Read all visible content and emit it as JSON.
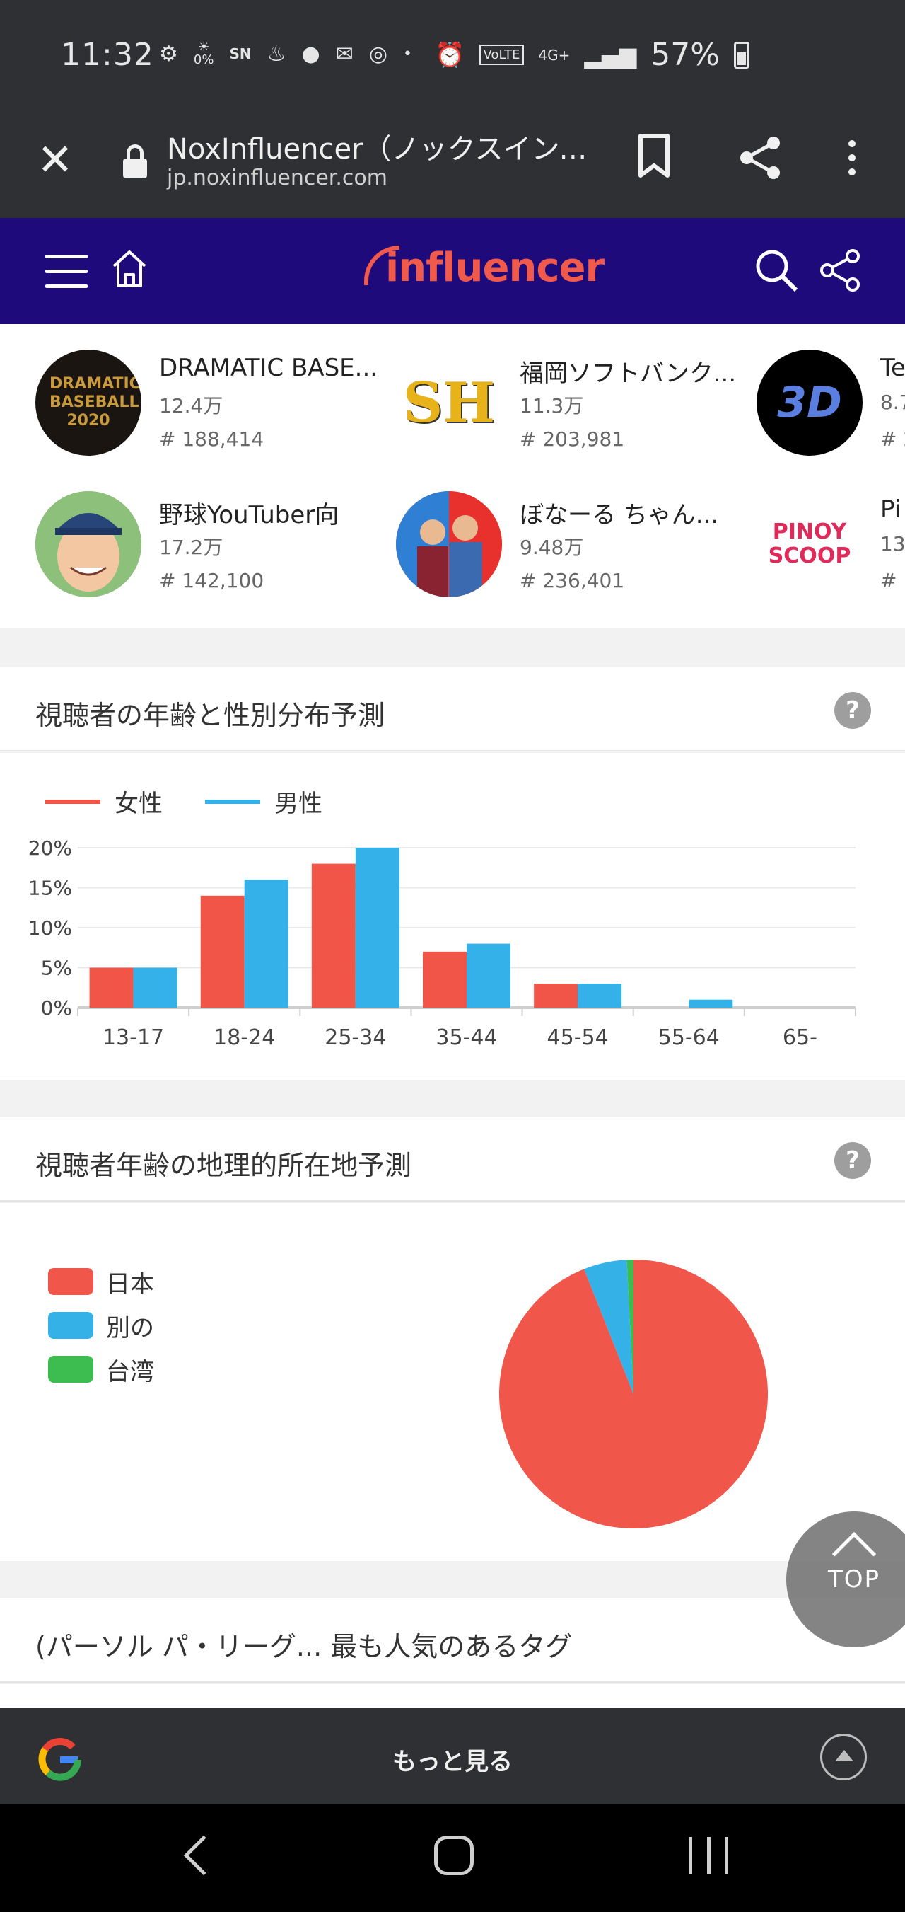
{
  "status_bar": {
    "time": "11:32",
    "notif_percent": "0%",
    "network": "4G+",
    "volte": "VoLTE",
    "battery": "57%"
  },
  "browser": {
    "page_title": "NoxInfluencer（ノックスインフ...",
    "domain": "jp.noxinfluencer.com"
  },
  "site": {
    "logo_text": "influencer",
    "brand_color": "#f05a4d",
    "header_color": "#1f0a7c"
  },
  "related_channels": [
    {
      "name": "DRAMATIC BASE...",
      "subs": "12.4万",
      "rank": "# 188,414",
      "avatar_text": "DRAMATIC BASEBALL 2020"
    },
    {
      "name": "福岡ソフトバンク...",
      "subs": "11.3万",
      "rank": "# 203,981",
      "avatar_text": "SH"
    },
    {
      "name": "Te",
      "subs": "8.7",
      "rank": "# 2",
      "avatar_text": "3D"
    },
    {
      "name": "野球YouTuber向",
      "subs": "17.2万",
      "rank": "# 142,100",
      "avatar_text": ""
    },
    {
      "name": "ぼなーる ちゃん...",
      "subs": "9.48万",
      "rank": "# 236,401",
      "avatar_text": ""
    },
    {
      "name": "Pi",
      "subs": "13",
      "rank": "# 1",
      "avatar_text": "PINOY SCOOP"
    }
  ],
  "age_gender_section": {
    "title": "視聴者の年齢と性別分布予測",
    "help": "?"
  },
  "geo_section": {
    "title": "視聴者年齢の地理的所在地予測",
    "help": "?"
  },
  "tags_section": {
    "title": "(パーソル パ・リーグ... 最も人気のあるタグ"
  },
  "top_button": {
    "label": "TOP"
  },
  "google_bar": {
    "label": "もっと見る"
  },
  "chart_data": [
    {
      "type": "bar",
      "categories": [
        "13-17",
        "18-24",
        "25-34",
        "35-44",
        "45-54",
        "55-64",
        "65-"
      ],
      "series": [
        {
          "name": "女性",
          "color": "#f05547",
          "values": [
            5,
            14,
            18,
            7,
            3,
            0,
            0
          ]
        },
        {
          "name": "男性",
          "color": "#33b1e8",
          "values": [
            5,
            16,
            20,
            8,
            3,
            1,
            0
          ]
        }
      ],
      "yticks": [
        "0%",
        "5%",
        "10%",
        "15%",
        "20%"
      ],
      "ylim": [
        0,
        20
      ],
      "grid": true,
      "legend": "top-left"
    },
    {
      "type": "pie",
      "labels": [
        "日本",
        "別の",
        "台湾"
      ],
      "values": [
        94,
        5.2,
        0.8
      ],
      "colors": [
        "#f0574a",
        "#34b2e8",
        "#3dbd4f"
      ],
      "legend": "left"
    }
  ]
}
